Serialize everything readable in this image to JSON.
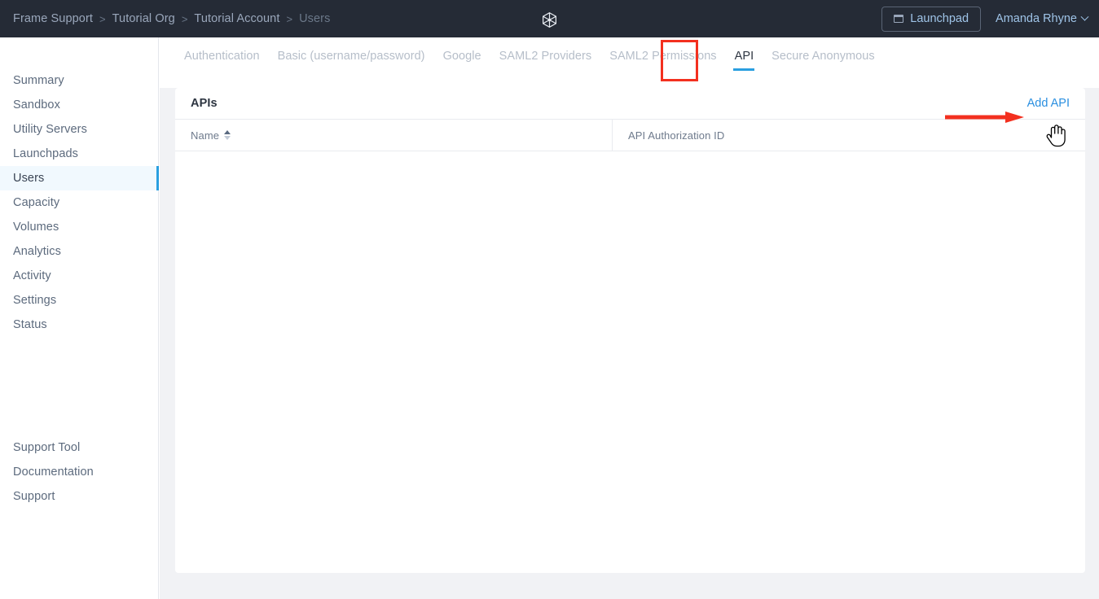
{
  "topbar": {
    "breadcrumb": [
      {
        "label": "Frame Support",
        "current": false
      },
      {
        "label": "Tutorial Org",
        "current": false
      },
      {
        "label": "Tutorial Account",
        "current": false
      },
      {
        "label": "Users",
        "current": true
      }
    ],
    "separator": ">",
    "logo_icon": "cube-logo-icon",
    "launchpad": {
      "label": "Launchpad",
      "icon": "window-icon"
    },
    "user": {
      "name": "Amanda Rhyne",
      "icon": "chevron-down-icon"
    },
    "bg_color": "#252b36"
  },
  "sidebar": {
    "top_items": [
      {
        "label": "Summary",
        "active": false
      },
      {
        "label": "Sandbox",
        "active": false
      },
      {
        "label": "Utility Servers",
        "active": false
      },
      {
        "label": "Launchpads",
        "active": false
      },
      {
        "label": "Users",
        "active": true
      },
      {
        "label": "Capacity",
        "active": false
      },
      {
        "label": "Volumes",
        "active": false
      },
      {
        "label": "Analytics",
        "active": false
      },
      {
        "label": "Activity",
        "active": false
      },
      {
        "label": "Settings",
        "active": false
      },
      {
        "label": "Status",
        "active": false
      }
    ],
    "bottom_items": [
      {
        "label": "Support Tool"
      },
      {
        "label": "Documentation"
      },
      {
        "label": "Support"
      }
    ],
    "active_color": "#2a9fe0",
    "active_bg": "#f1f9fe"
  },
  "tabs": [
    {
      "label": "Authentication",
      "active": false
    },
    {
      "label": "Basic (username/password)",
      "active": false
    },
    {
      "label": "Google",
      "active": false
    },
    {
      "label": "SAML2 Providers",
      "active": false
    },
    {
      "label": "SAML2 Permissions",
      "active": false
    },
    {
      "label": "API",
      "active": true
    },
    {
      "label": "Secure Anonymous",
      "active": false
    }
  ],
  "card": {
    "title": "APIs",
    "action_label": "Add API",
    "columns": [
      {
        "label": "Name",
        "sortable": true,
        "sort_icon": "sort-chevrons-icon"
      },
      {
        "label": "API Authorization ID",
        "sortable": false
      }
    ],
    "rows": []
  },
  "annotations": {
    "tab_highlight_color": "#f3301f",
    "arrow_color": "#f3301f",
    "arrow_target": "Add API",
    "cursor": "pointer-hand-cursor"
  }
}
